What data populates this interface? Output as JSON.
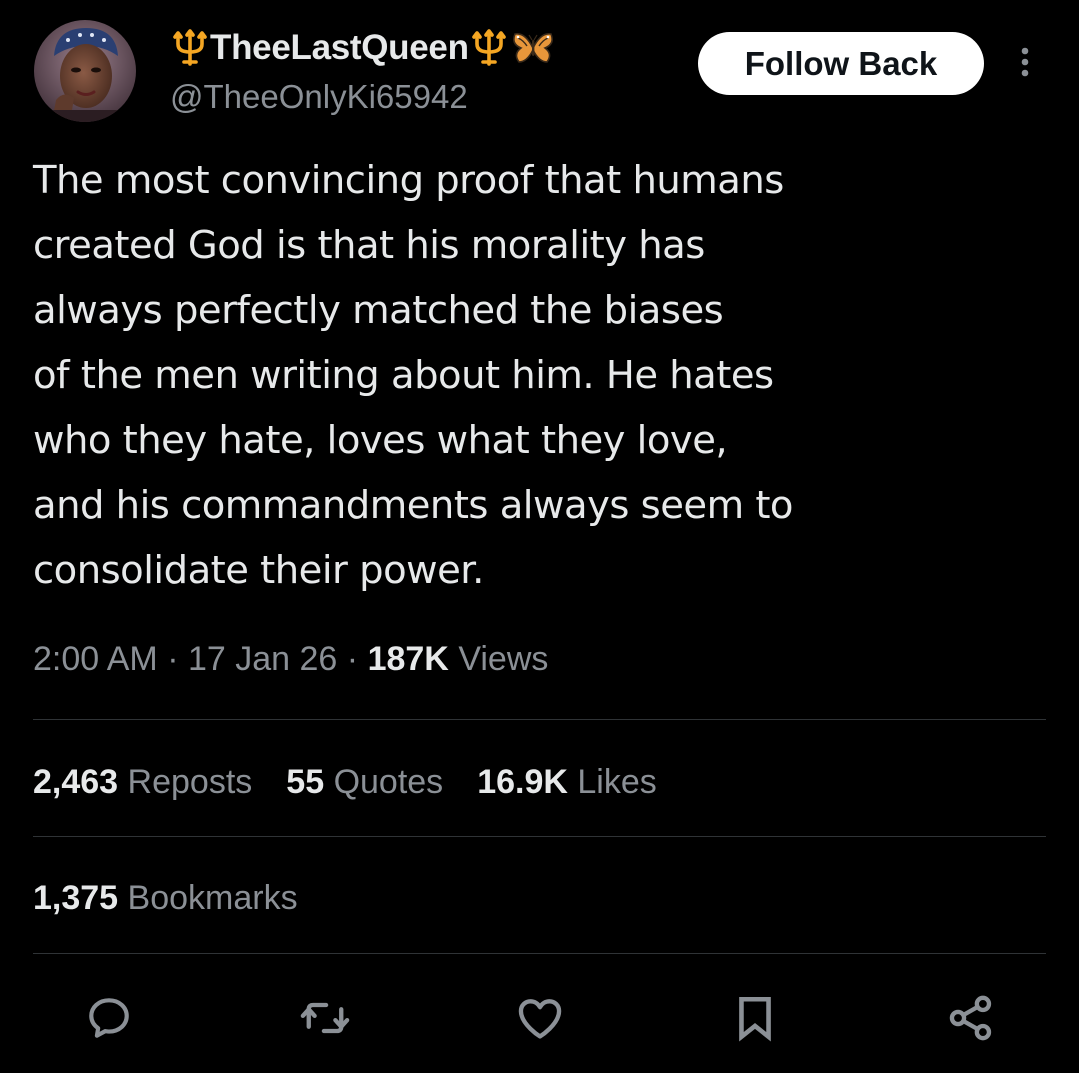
{
  "user": {
    "display_name": "TheeLastQueen",
    "handle": "@TheeOnlyKi65942",
    "emojis": [
      "trident-emoji",
      "trident-emoji",
      "butterfly-emoji"
    ]
  },
  "header": {
    "follow_label": "Follow Back",
    "more_icon": "more-vertical-icon"
  },
  "tweet": {
    "lines": [
      "The most convincing proof that humans",
      "created God is that his morality has",
      "always perfectly matched the biases",
      "of the men writing about him. He hates",
      "who they hate, loves what they love,",
      "and his commandments always seem to",
      "consolidate their power."
    ]
  },
  "meta": {
    "time": "2:00 AM",
    "date": "17 Jan 26",
    "separator": "·",
    "views_count": "187K",
    "views_label": "Views"
  },
  "stats": {
    "reposts_count": "2,463",
    "reposts_label": "Reposts",
    "quotes_count": "55",
    "quotes_label": "Quotes",
    "likes_count": "16.9K",
    "likes_label": "Likes",
    "bookmarks_count": "1,375",
    "bookmarks_label": "Bookmarks"
  },
  "actions": [
    "reply-icon",
    "repost-icon",
    "like-icon",
    "bookmark-icon",
    "share-icon"
  ],
  "colors": {
    "background": "#000000",
    "text": "#e7e9ea",
    "secondary": "#8b9096",
    "divider": "#2f3336",
    "button_bg": "#ffffff",
    "button_text": "#0f1419",
    "trident": "#f4a623",
    "icon": "#8b9096"
  }
}
